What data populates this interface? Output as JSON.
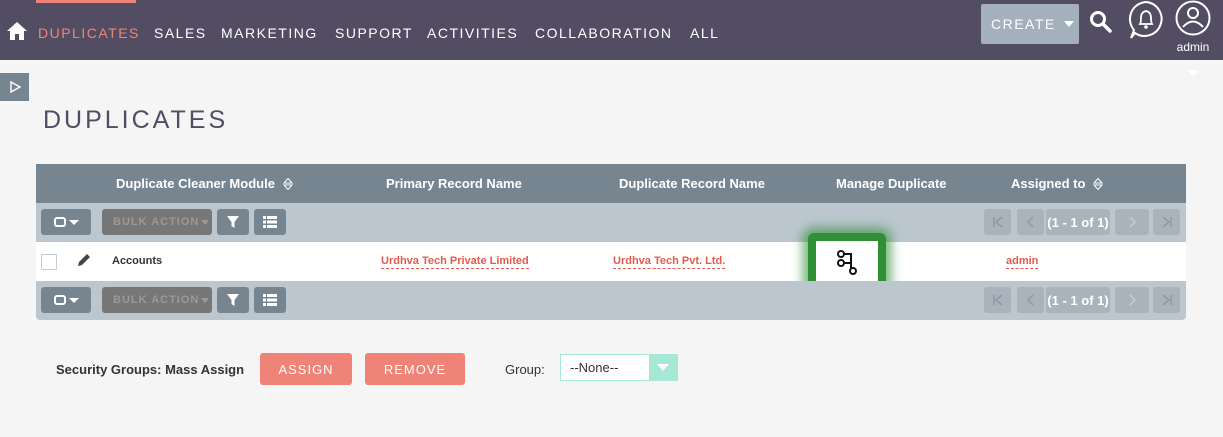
{
  "nav": {
    "items": [
      "DUPLICATES",
      "SALES",
      "MARKETING",
      "SUPPORT",
      "ACTIVITIES",
      "COLLABORATION",
      "ALL"
    ],
    "active": "DUPLICATES",
    "create_label": "CREATE",
    "user_label": "admin",
    "active_color": "#f08377"
  },
  "page": {
    "title": "DUPLICATES"
  },
  "table": {
    "columns": [
      "Duplicate Cleaner Module",
      "Primary Record Name",
      "Duplicate Record Name",
      "Manage Duplicate",
      "Assigned to"
    ],
    "bulk_action_label": "BULK ACTION",
    "pagination": "(1 - 1 of 1)",
    "rows": [
      {
        "module": "Accounts",
        "primary_record": "Urdhva Tech Private Limited",
        "duplicate_record": "Urdhva Tech Pvt. Ltd.",
        "manage_icon": "merge-icon",
        "assigned_to": "admin"
      }
    ]
  },
  "security_groups": {
    "label": "Security Groups: Mass Assign",
    "assign_label": "ASSIGN",
    "remove_label": "REMOVE",
    "group_label": "Group:",
    "group_value": "--None--"
  },
  "colors": {
    "topbar": "#534d64",
    "header": "#778591",
    "accent": "#f08377",
    "highlight": "#2e8f36"
  }
}
